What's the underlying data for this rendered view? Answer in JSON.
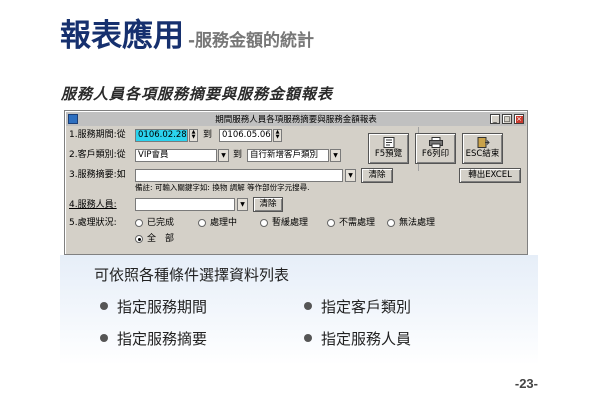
{
  "slide": {
    "title_main": "報表應用",
    "title_sub": "-服務金額的統計",
    "subtitle": "服務人員各項服務摘要與服務金額報表",
    "page_number": "-23-"
  },
  "window": {
    "title": "期間服務人員各項服務摘要與服務金額報表",
    "controls": {
      "minimize": "_",
      "maximize": "□",
      "close": "×"
    }
  },
  "form": {
    "period": {
      "label": "1.服務期間:從",
      "from_value": "0106.02.28",
      "to_label": "到",
      "to_value": "0106.05.06"
    },
    "customer": {
      "label": "2.客戶類別:從",
      "from_value": "VIP會員",
      "to_label": "到",
      "to_value": "自行新增客戶類別"
    },
    "summary": {
      "label": "3.服務摘要:如",
      "value": "",
      "clear_label": "清除",
      "note": "備註: 可輸入關鍵字如: 換物 調解 等作部份字元搜尋."
    },
    "staff": {
      "label": "4.服務人員:",
      "value": "",
      "clear_label": "清除"
    },
    "status": {
      "label": "5.處理狀況:",
      "options": [
        "已完成",
        "處理中",
        "暫緩處理",
        "不需處理",
        "無法處理",
        "全　部"
      ],
      "selected": "全　部"
    }
  },
  "actions": {
    "preview_label": "F5預覽",
    "print_label": "F6列印",
    "exit_label": "ESC結束",
    "export_label": "轉出EXCEL",
    "icons": [
      "preview-icon",
      "printer-icon",
      "exit-icon"
    ]
  },
  "bullets": {
    "heading": "可依照各種條件選擇資料列表",
    "items": [
      "指定服務期間",
      "指定客戶類別",
      "指定服務摘要",
      "指定服務人員"
    ]
  },
  "colors": {
    "title": "#16306e",
    "subtitle_gray": "#777777",
    "highlight_field": "#2bd3ee",
    "window_bg": "#d4d0c8"
  }
}
